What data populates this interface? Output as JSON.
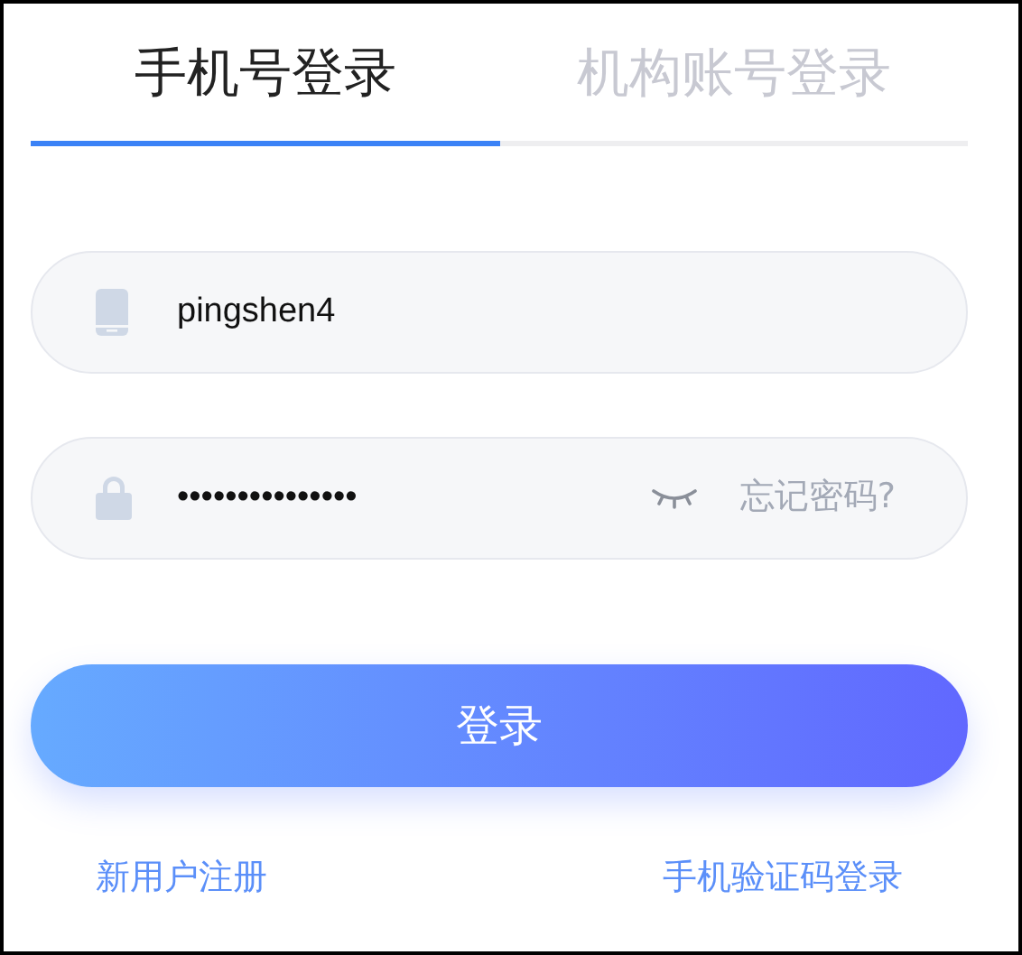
{
  "tabs": [
    {
      "label": "手机号登录",
      "selected": true
    },
    {
      "label": "机构账号登录",
      "selected": false
    }
  ],
  "phone_field": {
    "value": "pingshen4"
  },
  "password_field": {
    "value": "•••••••••••••••",
    "forgot_link": "忘记密码?"
  },
  "login_button": "登录",
  "links": [
    {
      "label": "新用户注册"
    },
    {
      "label": "手机验证码登录"
    }
  ]
}
